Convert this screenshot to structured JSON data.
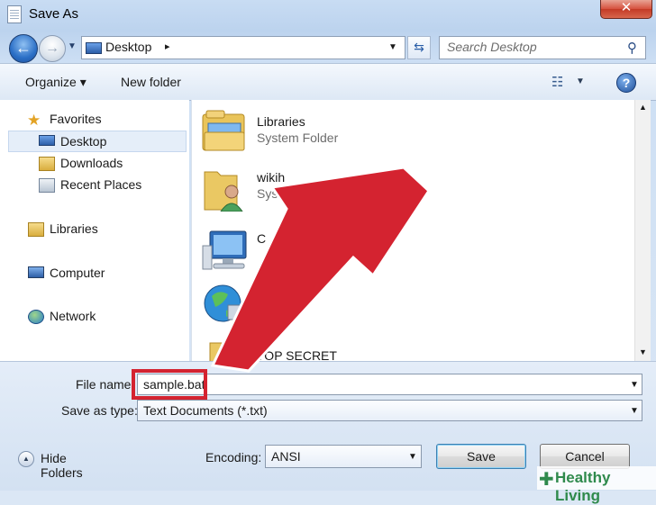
{
  "window": {
    "title": "Save As",
    "close_symbol": "✕"
  },
  "nav": {
    "back_symbol": "←",
    "forward_symbol": "→",
    "address": "Desktop",
    "address_separator": "▸",
    "search_placeholder": "Search Desktop"
  },
  "toolbar": {
    "organize": "Organize ▾",
    "new_folder": "New folder",
    "help": "?"
  },
  "sidebar": {
    "items": [
      {
        "label": "Favorites",
        "icon": "star-icon"
      },
      {
        "label": "Desktop",
        "icon": "desktop-icon",
        "selected": true
      },
      {
        "label": "Downloads",
        "icon": "downloads-folder-icon"
      },
      {
        "label": "Recent Places",
        "icon": "recent-places-icon"
      },
      {
        "label": "Libraries",
        "icon": "libraries-icon"
      },
      {
        "label": "Computer",
        "icon": "computer-icon"
      },
      {
        "label": "Network",
        "icon": "network-icon"
      }
    ]
  },
  "files": [
    {
      "name": "Libraries",
      "type": "System Folder",
      "icon": "libraries-folder-icon"
    },
    {
      "name": "wikih",
      "type": "Syst",
      "icon": "user-folder-icon"
    },
    {
      "name": "C",
      "type": "",
      "icon": "computer-icon"
    },
    {
      "name": "",
      "type": "",
      "icon": "network-globe-icon"
    },
    {
      "name": "TOP SECRET",
      "type": "",
      "icon": "folder-icon"
    }
  ],
  "bottom": {
    "filename_label": "File name:",
    "filename_value": "sample.bat",
    "savetype_label": "Save as type:",
    "savetype_value": "Text Documents (*.txt)",
    "hide_folders": "Hide Folders",
    "encoding_label": "Encoding:",
    "encoding_value": "ANSI",
    "save": "Save",
    "cancel": "Cancel"
  },
  "watermark": {
    "plus": "✚",
    "text": "Healthy Living"
  },
  "annotation": {
    "arrow_color": "#d42330",
    "highlight_color": "#d42330"
  }
}
